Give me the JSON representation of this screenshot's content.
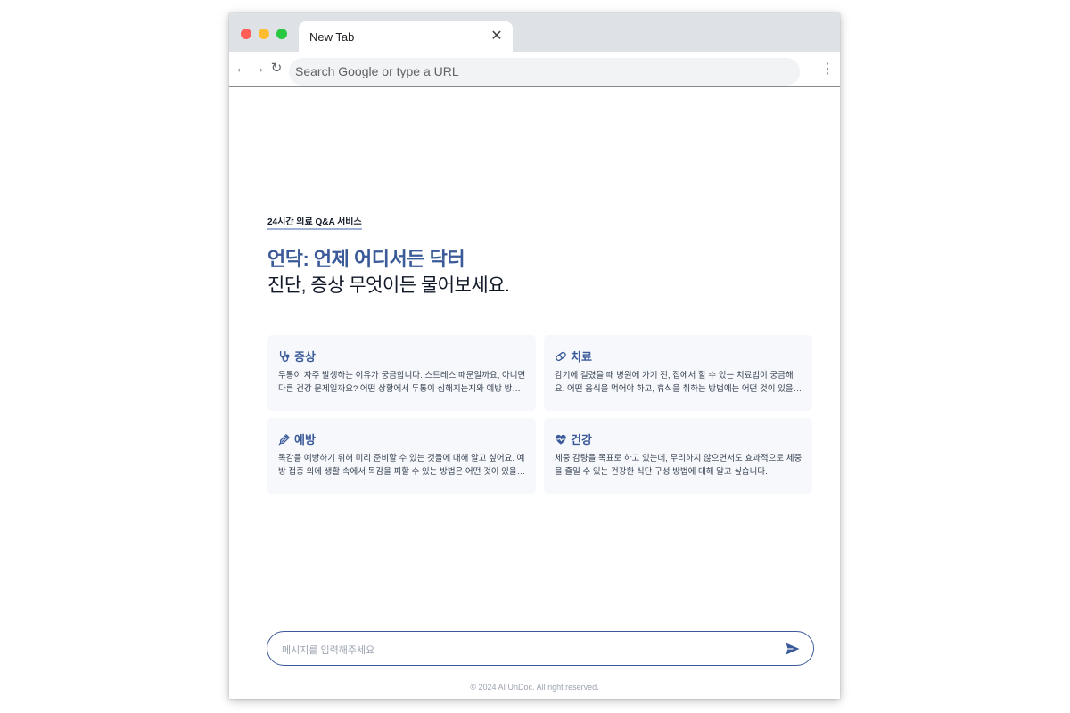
{
  "browser": {
    "tab_title": "New Tab",
    "tab_close_icon": "close-icon",
    "omnibox_placeholder": "Search Google or type a URL",
    "nav_back_icon": "arrow-left-icon",
    "nav_forward_icon": "arrow-right-icon",
    "nav_reload_icon": "reload-icon",
    "menu_icon": "more-vertical-icon",
    "glyphs": {
      "close": "✕",
      "back": "←",
      "forward": "→",
      "reload": "↻",
      "menu": "⋮"
    }
  },
  "hero": {
    "eyebrow": "24시간 의료 Q&A 서비스",
    "title": "언닥: 언제 어디서든 닥터",
    "subtitle": "진단, 증상 무엇이든 물어보세요."
  },
  "cards": [
    {
      "icon": "stethoscope-icon",
      "title": "증상",
      "body": "두통이 자주 발생하는 이유가 궁금합니다. 스트레스 때문일까요, 아니면 다른 건강 문제일까요? 어떤 상황에서 두통이 심해지는지와 예방 방법이 궁금합니다."
    },
    {
      "icon": "pill-icon",
      "title": "치료",
      "body": "감기에 걸렸을 때 병원에 가기 전, 집에서 할 수 있는 치료법이 궁금해요. 어떤 음식을 먹어야 하고, 휴식을 취하는 방법에는 어떤 것이 있을까요?"
    },
    {
      "icon": "syringe-icon",
      "title": "예방",
      "body": "독감을 예방하기 위해 미리 준비할 수 있는 것들에 대해 알고 싶어요. 예방 접종 외에 생활 속에서 독감을 피할 수 있는 방법은 어떤 것이 있을까요?"
    },
    {
      "icon": "heart-pulse-icon",
      "title": "건강",
      "body": "체중 감량을 목표로 하고 있는데, 무리하지 않으면서도 효과적으로 체중을 줄일 수 있는 건강한 식단 구성 방법에 대해 알고 싶습니다."
    }
  ],
  "chat": {
    "placeholder": "메시지를 입력해주세요",
    "send_icon": "send-icon"
  },
  "footer": {
    "text": "© 2024 AI UnDoc. All right reserved."
  },
  "colors": {
    "accent": "#3b5a99",
    "card_bg": "#f6f8fb",
    "tabstrip_bg": "#dee1e6"
  }
}
